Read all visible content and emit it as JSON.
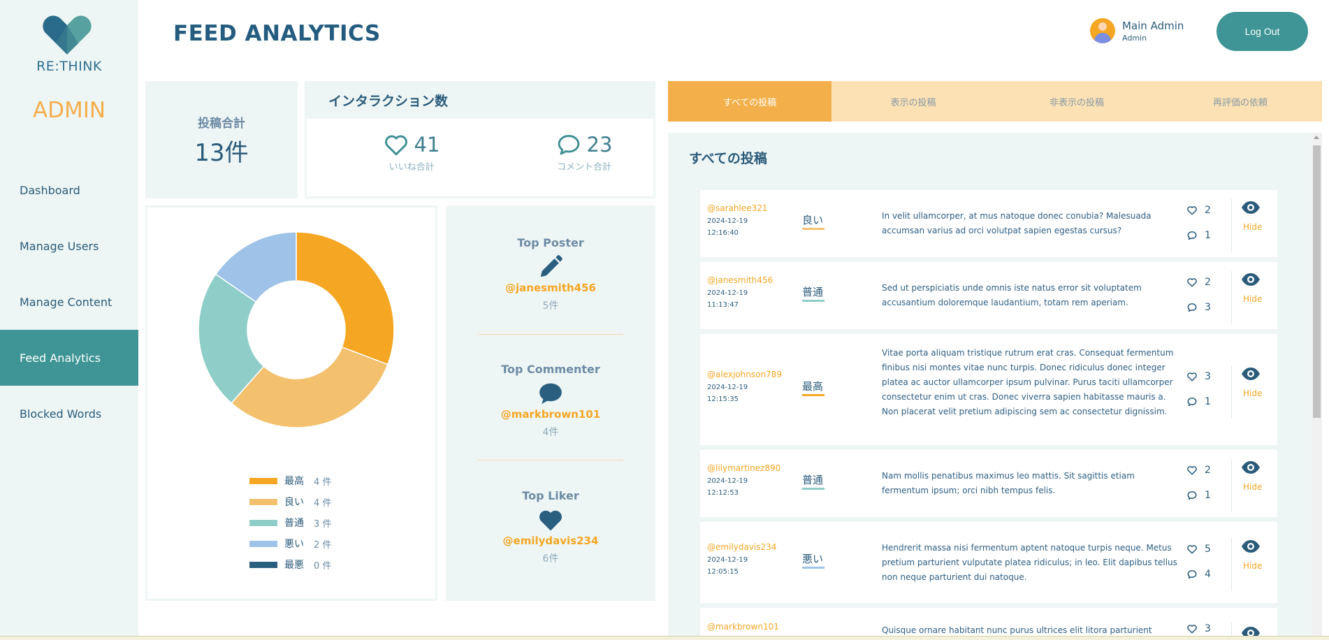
{
  "sidebar": {
    "brand": "RE:THINK",
    "admin_label": "ADMIN",
    "items": [
      {
        "label": "Dashboard"
      },
      {
        "label": "Manage Users"
      },
      {
        "label": "Manage Content"
      },
      {
        "label": "Feed Analytics"
      },
      {
        "label": "Blocked Words"
      }
    ],
    "active": "Feed Analytics"
  },
  "header": {
    "title": "FEED ANALYTICS",
    "user_name": "Main Admin",
    "user_role": "Admin",
    "logout_label": "Log Out"
  },
  "stats": {
    "total_label": "投稿合計",
    "total_value": "13件",
    "interactions_title": "インタラクション数",
    "likes_value": "41",
    "likes_label": "いいね合計",
    "comments_value": "23",
    "comments_label": "コメント合計"
  },
  "chart_data": {
    "type": "pie",
    "donut": true,
    "categories": [
      "最高",
      "良い",
      "普通",
      "悪い",
      "最悪"
    ],
    "values": [
      4,
      4,
      3,
      2,
      0
    ],
    "units": [
      "4 件",
      "4 件",
      "3 件",
      "2 件",
      "0 件"
    ],
    "colors": [
      "#f5a623",
      "#f3c06e",
      "#8ecdc8",
      "#9fc3e8",
      "#2a5f80"
    ],
    "legend_position": "bottom"
  },
  "top_users": {
    "poster": {
      "title": "Top Poster",
      "user": "@janesmith456",
      "count": "5件"
    },
    "commenter": {
      "title": "Top Commenter",
      "user": "@markbrown101",
      "count": "4件"
    },
    "liker": {
      "title": "Top Liker",
      "user": "@emilydavis234",
      "count": "6件"
    }
  },
  "tabs": [
    {
      "label": "すべての投稿",
      "active": true
    },
    {
      "label": "表示の投稿",
      "active": false
    },
    {
      "label": "非表示の投稿",
      "active": false
    },
    {
      "label": "再評価の依頼",
      "active": false
    }
  ],
  "posts_panel": {
    "title": "すべての投稿",
    "hide_label": "Hide",
    "posts": [
      {
        "user": "@sarahlee321",
        "date": "2024-12-19",
        "time": "12:16:40",
        "rating": "良い",
        "rating_color": "#f3c06e",
        "text": "In velit ullamcorper, at mus natoque donec conubia? Malesuada accumsan varius ad orci volutpat sapien egestas cursus?",
        "likes": "2",
        "comments": "1"
      },
      {
        "user": "@janesmith456",
        "date": "2024-12-19",
        "time": "11:13:47",
        "rating": "普通",
        "rating_color": "#8ecdc8",
        "text": "Sed ut perspiciatis unde omnis iste natus error sit voluptatem accusantium doloremque laudantium, totam rem aperiam.",
        "likes": "2",
        "comments": "3"
      },
      {
        "user": "@alexjohnson789",
        "date": "2024-12-19",
        "time": "12:15:35",
        "rating": "最高",
        "rating_color": "#f5a623",
        "text": "Vitae porta aliquam tristique rutrum erat cras. Consequat fermentum finibus nisi montes vitae nunc turpis. Donec ridiculus donec integer platea ac auctor ullamcorper ipsum pulvinar. Purus taciti ullamcorper consectetur enim ut cras. Donec viverra sapien habitasse mauris a. Non placerat velit pretium adipiscing sem ac consectetur dignissim.",
        "likes": "3",
        "comments": "1"
      },
      {
        "user": "@lilymartinez890",
        "date": "2024-12-19",
        "time": "12:12:53",
        "rating": "普通",
        "rating_color": "#8ecdc8",
        "text": "Nam mollis penatibus maximus leo mattis. Sit sagittis etiam fermentum ipsum; orci nibh tempus felis.",
        "likes": "2",
        "comments": "1"
      },
      {
        "user": "@emilydavis234",
        "date": "2024-12-19",
        "time": "12:05:15",
        "rating": "悪い",
        "rating_color": "#9fc3e8",
        "text": "Hendrerit massa nisi fermentum aptent natoque turpis neque. Metus pretium parturient vulputate platea ridiculus; in leo. Elit dapibus tellus non neque parturient dui natoque.",
        "likes": "5",
        "comments": "4"
      },
      {
        "user": "@markbrown101",
        "date": "",
        "time": "",
        "rating": "",
        "rating_color": "#ffffff",
        "text": "Quisque ornare habitant nunc purus ultrices elit litora parturient",
        "likes": "3",
        "comments": ""
      }
    ]
  }
}
